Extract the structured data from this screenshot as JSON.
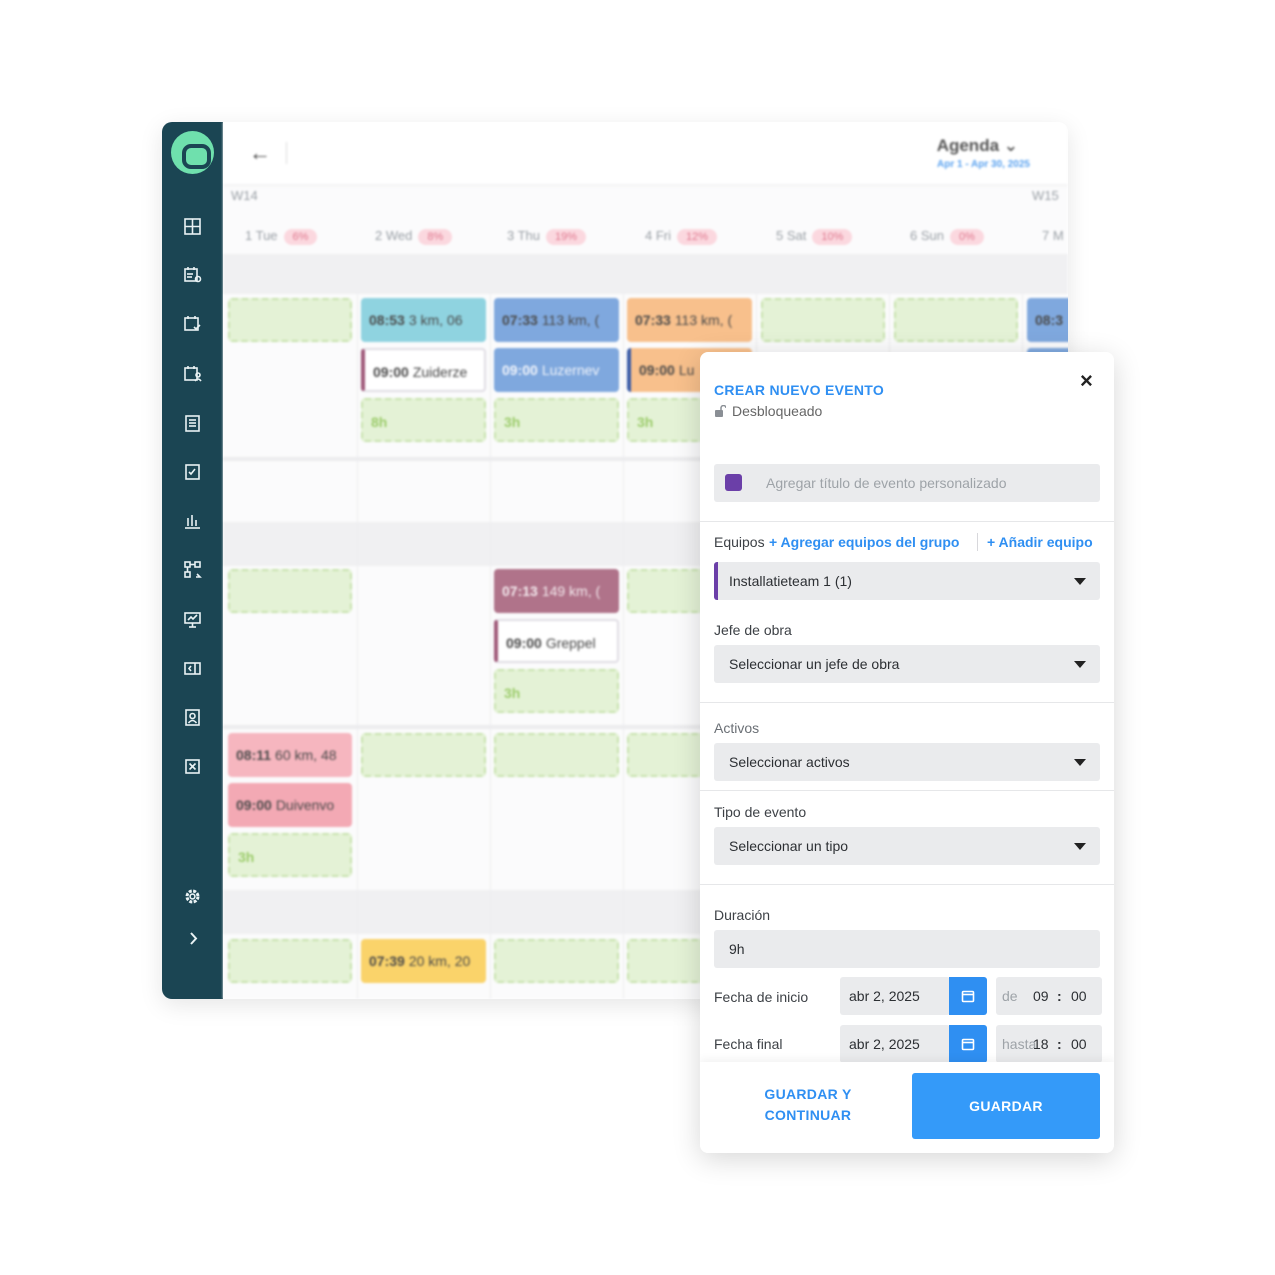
{
  "header": {
    "title": "Agenda",
    "range": "Apr 1 - Apr 30, 2025",
    "weeks": [
      "W14",
      "W15"
    ]
  },
  "days": [
    {
      "label": "1 Tue",
      "pct": "6%"
    },
    {
      "label": "2 Wed",
      "pct": "8%"
    },
    {
      "label": "3 Thu",
      "pct": "19%"
    },
    {
      "label": "4 Fri",
      "pct": "12%"
    },
    {
      "label": "5 Sat",
      "pct": "10%"
    },
    {
      "label": "6 Sun",
      "pct": "0%"
    },
    {
      "label": "7 M",
      "pct": ""
    }
  ],
  "events": {
    "e1": {
      "time": "08:53",
      "text": "3 km, 06"
    },
    "e2": {
      "time": "07:33",
      "text": "113 km, ("
    },
    "e3": {
      "time": "07:33",
      "text": "113 km, ("
    },
    "e4": {
      "time": "08:3",
      "text": ""
    },
    "e5": {
      "time": "09:00",
      "text": "Zuiderze"
    },
    "e6": {
      "time": "09:00",
      "text": "Luzernev"
    },
    "e7": {
      "time": "09:00",
      "text": "Lu"
    },
    "h1": "8h",
    "h2": "3h",
    "h3": "3h",
    "e8": {
      "time": "07:13",
      "text": "149 km, ("
    },
    "e9": {
      "time": "09:00",
      "text": "Greppel"
    },
    "h4": "3h",
    "e10": {
      "time": "08:11",
      "text": "60 km, 48"
    },
    "e11": {
      "time": "09:00",
      "text": "Duivenvo"
    },
    "h5": "3h",
    "e12": {
      "time": "07:39",
      "text": "20 km, 20"
    }
  },
  "modal": {
    "title": "CREAR NUEVO EVENTO",
    "lock_status": "Desbloqueado",
    "title_placeholder": "Agregar título de evento personalizado",
    "teams_label": "Equipos",
    "add_group_teams": "+ Agregar equipos del grupo",
    "add_team": "+ Añadir equipo",
    "team_value": "Installatieteam 1 (1)",
    "supervisor_label": "Jefe de obra",
    "supervisor_value": "Seleccionar un jefe de obra",
    "assets_label": "Activos",
    "assets_value": "Seleccionar activos",
    "type_label": "Tipo de evento",
    "type_value": "Seleccionar un tipo",
    "duration_label": "Duración",
    "duration_value": "9h",
    "start_label": "Fecha de inicio",
    "start_date": "abr 2, 2025",
    "start_prefix": "de",
    "start_hour": "09",
    "start_min": "00",
    "end_label": "Fecha final",
    "end_date": "abr 2, 2025",
    "end_prefix": "hasta",
    "end_hour": "18",
    "end_min": "00",
    "time_sep": ":",
    "save_continue": "GUARDAR Y CONTINUAR",
    "save": "GUARDAR"
  },
  "colors": {
    "sidebar": "#1b4553",
    "accent": "#2f8ff2",
    "primary_button": "#349af9",
    "team_color": "#6b3fa8",
    "logo": "#6fe0ad"
  }
}
